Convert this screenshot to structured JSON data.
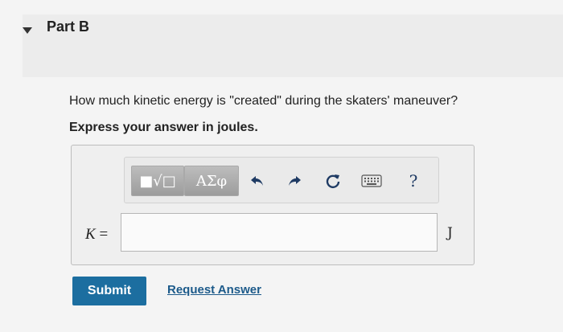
{
  "part": {
    "title": "Part B"
  },
  "question": {
    "text": "How much kinetic energy is \"created\" during the skaters' maneuver?",
    "instruction": "Express your answer in joules."
  },
  "toolbar": {
    "templates_label": "■√□",
    "symbols_label": "ΑΣφ",
    "undo_icon": "undo-icon",
    "redo_icon": "redo-icon",
    "reset_icon": "reset-icon",
    "keyboard_icon": "keyboard-icon",
    "help_label": "?"
  },
  "answer": {
    "variable": "K",
    "equals": " =",
    "value": "",
    "unit": "J"
  },
  "actions": {
    "submit_label": "Submit",
    "request_label": "Request Answer"
  },
  "colors": {
    "submit_bg": "#1c6ea0",
    "link": "#1c5a8a",
    "toolbar_icon": "#1f3b64"
  }
}
